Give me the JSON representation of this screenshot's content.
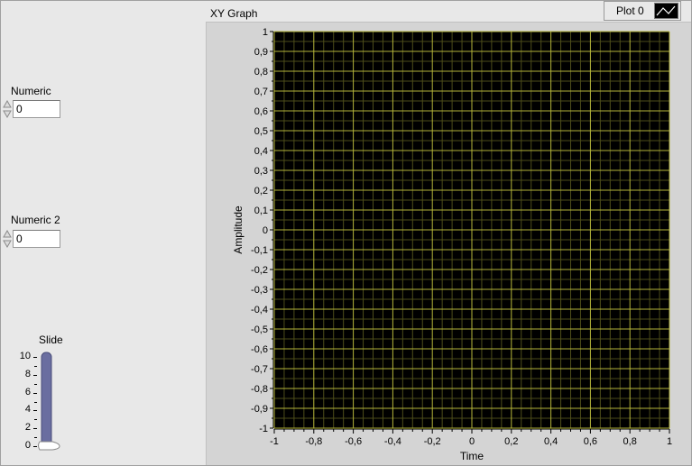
{
  "controls": {
    "numeric": {
      "label": "Numeric",
      "value": "0"
    },
    "numeric2": {
      "label": "Numeric 2",
      "value": "0"
    },
    "slide": {
      "label": "Slide",
      "value": 0,
      "ticks": [
        "10",
        "8",
        "6",
        "4",
        "2",
        "0"
      ],
      "min": 0,
      "max": 10
    }
  },
  "graph": {
    "title": "XY Graph",
    "legend": {
      "label": "Plot 0"
    },
    "colors": {
      "plot_bg": "#000000",
      "grid_major": "#b5b53a",
      "grid_minor": "#4d4d1a",
      "slide_fill": "#6a6ea0"
    }
  },
  "chart_data": {
    "type": "line",
    "title": "XY Graph",
    "xlabel": "Time",
    "ylabel": "Amplitude",
    "xlim": [
      -1,
      1
    ],
    "ylim": [
      -1,
      1
    ],
    "x_ticks": [
      "-1",
      "-0,8",
      "-0,6",
      "-0,4",
      "-0,2",
      "0",
      "0,2",
      "0,4",
      "0,6",
      "0,8",
      "1"
    ],
    "y_ticks": [
      "1",
      "0,9",
      "0,8",
      "0,7",
      "0,6",
      "0,5",
      "0,4",
      "0,3",
      "0,2",
      "0,1",
      "0",
      "-0,1",
      "-0,2",
      "-0,3",
      "-0,4",
      "-0,5",
      "-0,6",
      "-0,7",
      "-0,8",
      "-0,9",
      "-1"
    ],
    "grid": true,
    "series": [
      {
        "name": "Plot 0",
        "x": [],
        "y": []
      }
    ]
  }
}
